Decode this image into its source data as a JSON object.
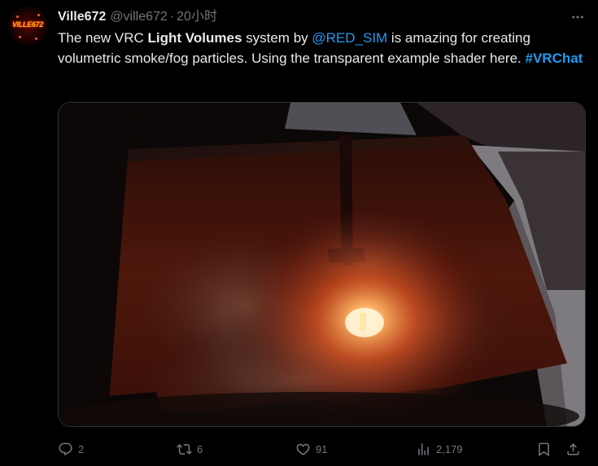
{
  "author": {
    "display_name": "Ville672",
    "handle": "@ville672",
    "separator": "·",
    "time": "20小时",
    "avatar_logo_text": "VILLE672"
  },
  "tweet": {
    "part1": "The new VRC ",
    "bold": "Light Volumes",
    "part2": " system by ",
    "mention": "@RED_SIM",
    "part3": " is amazing for creating volumetric smoke/fog particles. Using the transparent example shader here. ",
    "hashtag": "#VRChat"
  },
  "actions": {
    "replies": "2",
    "reposts": "6",
    "likes": "91",
    "views": "2,179"
  },
  "icons": [
    "more-icon",
    "reply-icon",
    "repost-icon",
    "like-icon",
    "views-icon",
    "bookmark-icon",
    "share-icon"
  ],
  "colors": {
    "background": "#000000",
    "text": "#e7e9ea",
    "muted": "#71767b",
    "link": "#1d9bf0"
  }
}
